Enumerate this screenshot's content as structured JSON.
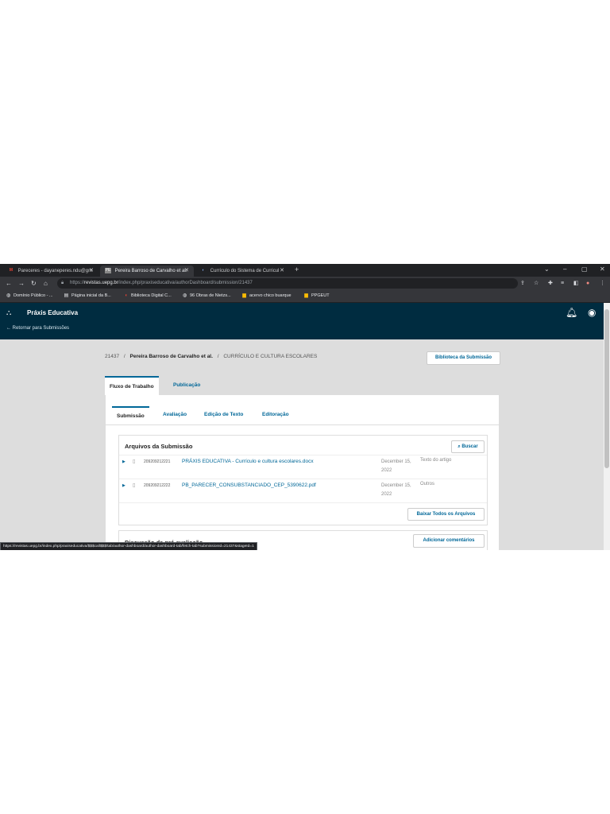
{
  "browser": {
    "tabs": [
      {
        "favicon": "M",
        "title": "Pareceres - dayaneperes.ndu@gm",
        "close": "✕"
      },
      {
        "favicon": "PE",
        "title": "Pereira Barroso de Carvalho et al.",
        "close": "✕"
      },
      {
        "favicon": "◐",
        "title": "Currículo do Sistema de Curricul",
        "close": "✕"
      }
    ],
    "new_tab": "+",
    "url_scheme": "https://",
    "url_host": "revistas.uepg.br",
    "url_path": "/index.php/praxiseducativa/authorDashboard/submission/21437",
    "bookmarks": [
      "Domínio Público - ...",
      "Página inicial da B...",
      "Biblioteca Digital C...",
      "96 Obras de Nietzs...",
      "acervo chico buarque",
      "PPGEUT"
    ],
    "status_url": "https://revistas.uepg.br/index.php/praxiseducativa/$$$call$$$/tab/author-dashboard/author-dashboard-tab/fetch-tab?submissionId=21437&stageId=1"
  },
  "app": {
    "title": "Práxis Educativa",
    "back_link": "← Retornar para Submissões",
    "submission_id": "21437",
    "authors": "Pereira Barroso de Carvalho et al.",
    "submission_title": "CURRÍCULO E CULTURA ESCOLARES",
    "library_button": "Biblioteca da Submissão",
    "main_tabs": [
      "Fluxo de Trabalho",
      "Publicação"
    ],
    "stage_tabs": [
      "Submissão",
      "Avaliação",
      "Edição de Texto",
      "Editoração"
    ],
    "files_panel": {
      "title": "Arquivos da Submissão",
      "search_button": "Buscar",
      "files": [
        {
          "id": "209209212221",
          "name": "PRÁXIS EDUCATIVA - Currículo e cultura escolares.docx",
          "date": "December 15, 2022",
          "type": "Texto do artigo"
        },
        {
          "id": "209209212222",
          "name": "PB_PARECER_CONSUBSTANCIADO_CEP_5390622.pdf",
          "date": "December 15, 2022",
          "type": "Outros"
        }
      ],
      "download_all_button": "Baixar Todos os Arquivos"
    },
    "discussion_panel": {
      "title": "Discussão da pré-avaliação",
      "add_button": "Adicionar comentários"
    }
  },
  "colors": {
    "header": "#002c40",
    "link": "#006798",
    "chrome": "#202124"
  }
}
